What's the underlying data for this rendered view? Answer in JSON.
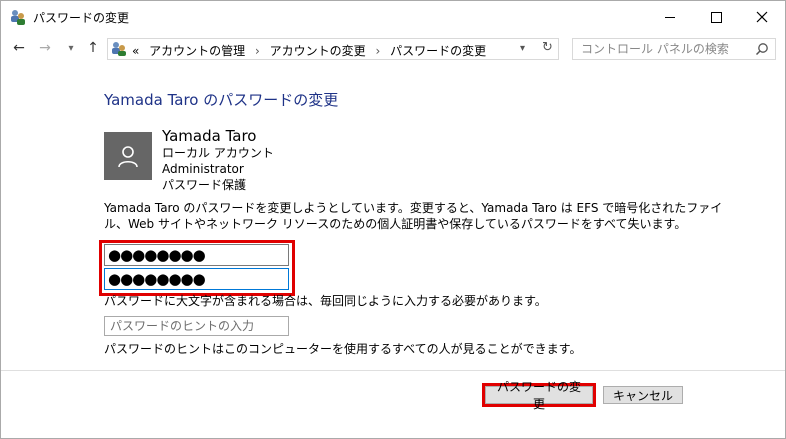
{
  "window": {
    "title": "パスワードの変更"
  },
  "address": {
    "overflow": "«",
    "crumbs": [
      "アカウントの管理",
      "アカウントの変更",
      "パスワードの変更"
    ],
    "separator": "›"
  },
  "search": {
    "placeholder": "コントロール パネルの検索"
  },
  "page": {
    "heading": "Yamada Taro のパスワードの変更",
    "user": {
      "name": "Yamada Taro",
      "type": "ローカル アカウント",
      "role": "Administrator",
      "protection": "パスワード保護"
    },
    "description": "Yamada Taro のパスワードを変更しようとしています。変更すると、Yamada Taro は EFS で暗号化されたファイル、Web サイトやネットワーク リソースのための個人証明書や保存しているパスワードをすべて失います。",
    "new_password_mask": "●●●●●●●●",
    "confirm_password_mask": "●●●●●●●●",
    "caps_notice": "パスワードに大文字が含まれる場合は、毎回同じように入力する必要があります。",
    "hint_placeholder": "パスワードのヒントの入力",
    "hint_description": "パスワードのヒントはこのコンピューターを使用するすべての人が見ることができます。"
  },
  "buttons": {
    "change": "パスワードの変更",
    "cancel": "キャンセル"
  },
  "colors": {
    "heading": "#1e3287",
    "highlight": "#e00000",
    "focus": "#0078d7"
  }
}
